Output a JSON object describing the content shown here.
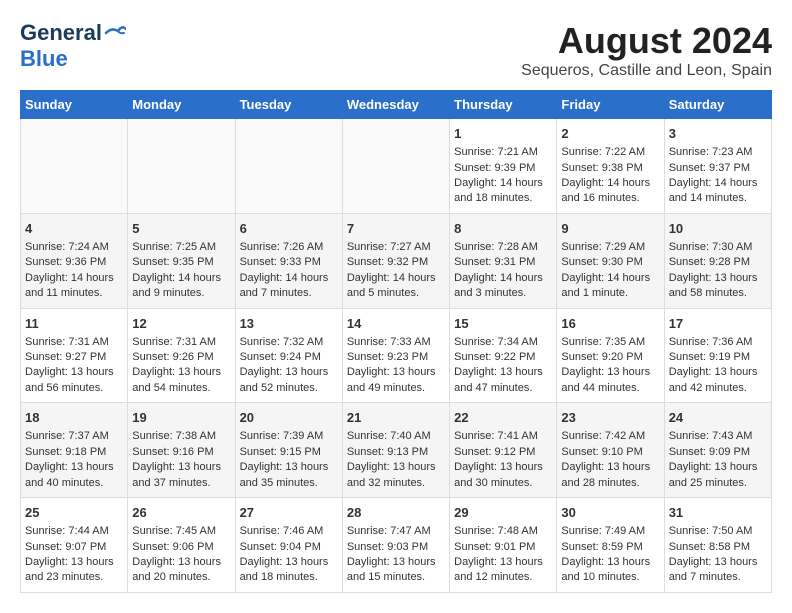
{
  "logo": {
    "general": "General",
    "blue": "Blue"
  },
  "title": "August 2024",
  "subtitle": "Sequeros, Castille and Leon, Spain",
  "days_of_week": [
    "Sunday",
    "Monday",
    "Tuesday",
    "Wednesday",
    "Thursday",
    "Friday",
    "Saturday"
  ],
  "weeks": [
    [
      {
        "day": "",
        "content": ""
      },
      {
        "day": "",
        "content": ""
      },
      {
        "day": "",
        "content": ""
      },
      {
        "day": "",
        "content": ""
      },
      {
        "day": "1",
        "content": "Sunrise: 7:21 AM\nSunset: 9:39 PM\nDaylight: 14 hours\nand 18 minutes."
      },
      {
        "day": "2",
        "content": "Sunrise: 7:22 AM\nSunset: 9:38 PM\nDaylight: 14 hours\nand 16 minutes."
      },
      {
        "day": "3",
        "content": "Sunrise: 7:23 AM\nSunset: 9:37 PM\nDaylight: 14 hours\nand 14 minutes."
      }
    ],
    [
      {
        "day": "4",
        "content": "Sunrise: 7:24 AM\nSunset: 9:36 PM\nDaylight: 14 hours\nand 11 minutes."
      },
      {
        "day": "5",
        "content": "Sunrise: 7:25 AM\nSunset: 9:35 PM\nDaylight: 14 hours\nand 9 minutes."
      },
      {
        "day": "6",
        "content": "Sunrise: 7:26 AM\nSunset: 9:33 PM\nDaylight: 14 hours\nand 7 minutes."
      },
      {
        "day": "7",
        "content": "Sunrise: 7:27 AM\nSunset: 9:32 PM\nDaylight: 14 hours\nand 5 minutes."
      },
      {
        "day": "8",
        "content": "Sunrise: 7:28 AM\nSunset: 9:31 PM\nDaylight: 14 hours\nand 3 minutes."
      },
      {
        "day": "9",
        "content": "Sunrise: 7:29 AM\nSunset: 9:30 PM\nDaylight: 14 hours\nand 1 minute."
      },
      {
        "day": "10",
        "content": "Sunrise: 7:30 AM\nSunset: 9:28 PM\nDaylight: 13 hours\nand 58 minutes."
      }
    ],
    [
      {
        "day": "11",
        "content": "Sunrise: 7:31 AM\nSunset: 9:27 PM\nDaylight: 13 hours\nand 56 minutes."
      },
      {
        "day": "12",
        "content": "Sunrise: 7:31 AM\nSunset: 9:26 PM\nDaylight: 13 hours\nand 54 minutes."
      },
      {
        "day": "13",
        "content": "Sunrise: 7:32 AM\nSunset: 9:24 PM\nDaylight: 13 hours\nand 52 minutes."
      },
      {
        "day": "14",
        "content": "Sunrise: 7:33 AM\nSunset: 9:23 PM\nDaylight: 13 hours\nand 49 minutes."
      },
      {
        "day": "15",
        "content": "Sunrise: 7:34 AM\nSunset: 9:22 PM\nDaylight: 13 hours\nand 47 minutes."
      },
      {
        "day": "16",
        "content": "Sunrise: 7:35 AM\nSunset: 9:20 PM\nDaylight: 13 hours\nand 44 minutes."
      },
      {
        "day": "17",
        "content": "Sunrise: 7:36 AM\nSunset: 9:19 PM\nDaylight: 13 hours\nand 42 minutes."
      }
    ],
    [
      {
        "day": "18",
        "content": "Sunrise: 7:37 AM\nSunset: 9:18 PM\nDaylight: 13 hours\nand 40 minutes."
      },
      {
        "day": "19",
        "content": "Sunrise: 7:38 AM\nSunset: 9:16 PM\nDaylight: 13 hours\nand 37 minutes."
      },
      {
        "day": "20",
        "content": "Sunrise: 7:39 AM\nSunset: 9:15 PM\nDaylight: 13 hours\nand 35 minutes."
      },
      {
        "day": "21",
        "content": "Sunrise: 7:40 AM\nSunset: 9:13 PM\nDaylight: 13 hours\nand 32 minutes."
      },
      {
        "day": "22",
        "content": "Sunrise: 7:41 AM\nSunset: 9:12 PM\nDaylight: 13 hours\nand 30 minutes."
      },
      {
        "day": "23",
        "content": "Sunrise: 7:42 AM\nSunset: 9:10 PM\nDaylight: 13 hours\nand 28 minutes."
      },
      {
        "day": "24",
        "content": "Sunrise: 7:43 AM\nSunset: 9:09 PM\nDaylight: 13 hours\nand 25 minutes."
      }
    ],
    [
      {
        "day": "25",
        "content": "Sunrise: 7:44 AM\nSunset: 9:07 PM\nDaylight: 13 hours\nand 23 minutes."
      },
      {
        "day": "26",
        "content": "Sunrise: 7:45 AM\nSunset: 9:06 PM\nDaylight: 13 hours\nand 20 minutes."
      },
      {
        "day": "27",
        "content": "Sunrise: 7:46 AM\nSunset: 9:04 PM\nDaylight: 13 hours\nand 18 minutes."
      },
      {
        "day": "28",
        "content": "Sunrise: 7:47 AM\nSunset: 9:03 PM\nDaylight: 13 hours\nand 15 minutes."
      },
      {
        "day": "29",
        "content": "Sunrise: 7:48 AM\nSunset: 9:01 PM\nDaylight: 13 hours\nand 12 minutes."
      },
      {
        "day": "30",
        "content": "Sunrise: 7:49 AM\nSunset: 8:59 PM\nDaylight: 13 hours\nand 10 minutes."
      },
      {
        "day": "31",
        "content": "Sunrise: 7:50 AM\nSunset: 8:58 PM\nDaylight: 13 hours\nand 7 minutes."
      }
    ]
  ]
}
